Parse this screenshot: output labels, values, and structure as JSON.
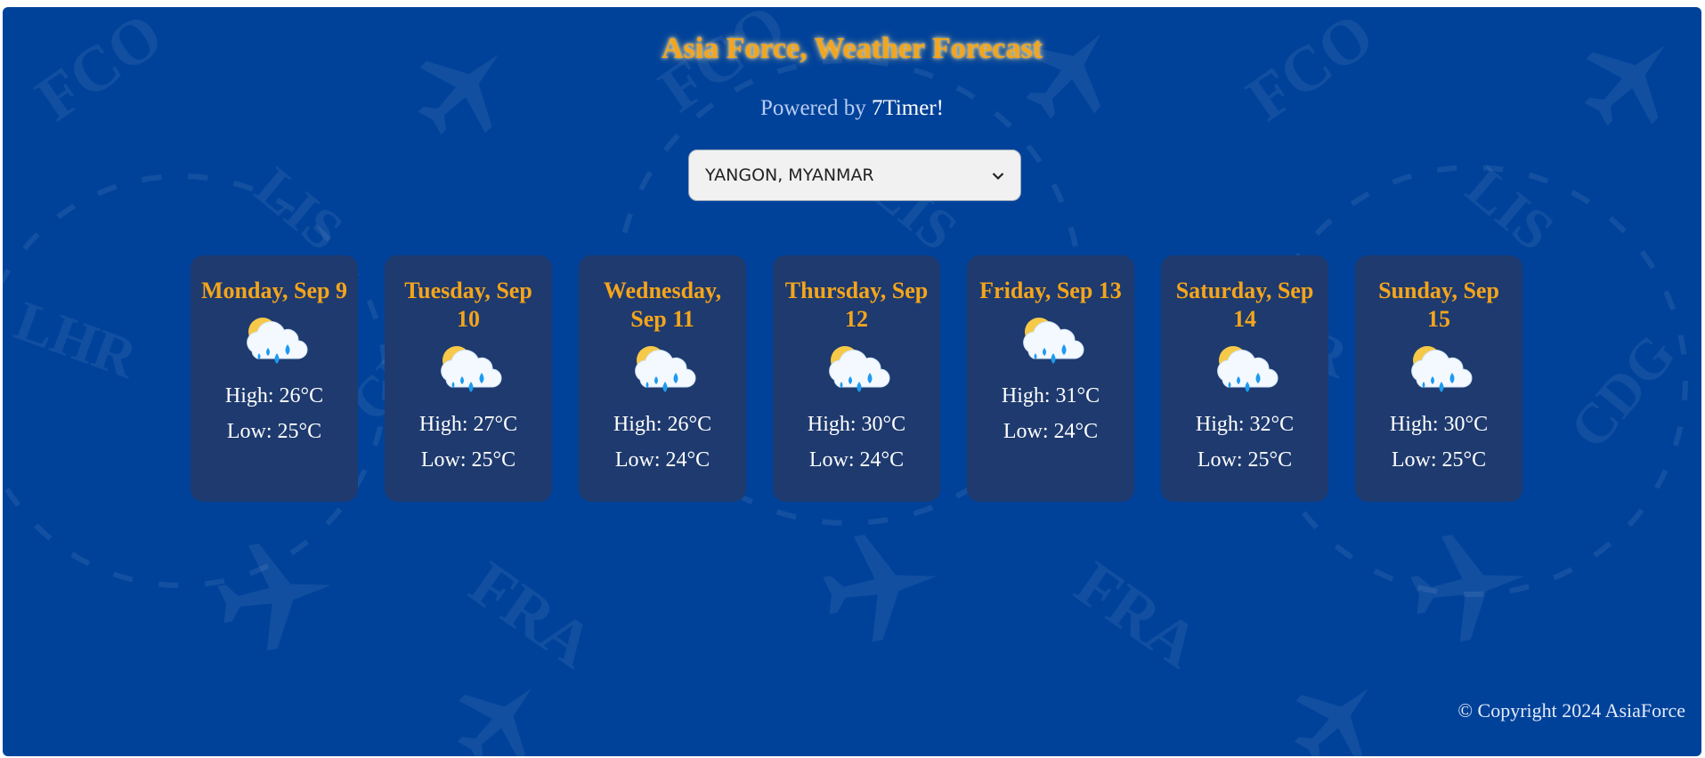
{
  "header": {
    "title": "Asia Force, Weather Forecast",
    "powered_prefix": "Powered by ",
    "powered_link": "7Timer!"
  },
  "city_select": {
    "selected": "YANGON, MYANMAR"
  },
  "forecast": [
    {
      "day": "Monday, Sep 9",
      "high": "High: 26°C",
      "low": "Low: 25°C",
      "icon": "partly-cloudy-rain-icon"
    },
    {
      "day": "Tuesday, Sep 10",
      "high": "High: 27°C",
      "low": "Low: 25°C",
      "icon": "partly-cloudy-rain-icon"
    },
    {
      "day": "Wednesday, Sep 11",
      "high": "High: 26°C",
      "low": "Low: 24°C",
      "icon": "partly-cloudy-rain-icon"
    },
    {
      "day": "Thursday, Sep 12",
      "high": "High: 30°C",
      "low": "Low: 24°C",
      "icon": "partly-cloudy-rain-icon"
    },
    {
      "day": "Friday, Sep 13",
      "high": "High: 31°C",
      "low": "Low: 24°C",
      "icon": "partly-cloudy-rain-icon"
    },
    {
      "day": "Saturday, Sep 14",
      "high": "High: 32°C",
      "low": "Low: 25°C",
      "icon": "partly-cloudy-rain-icon"
    },
    {
      "day": "Sunday, Sep 15",
      "high": "High: 30°C",
      "low": "Low: 25°C",
      "icon": "partly-cloudy-rain-icon"
    }
  ],
  "footer": {
    "copyright": "© Copyright 2024 AsiaForce"
  },
  "background_watermark": [
    "FCO",
    "LHR",
    "LIS",
    "FRA",
    "CDG"
  ],
  "colors": {
    "background": "#00429a",
    "card": "#1e3a6e",
    "accent": "#f4a51c"
  }
}
